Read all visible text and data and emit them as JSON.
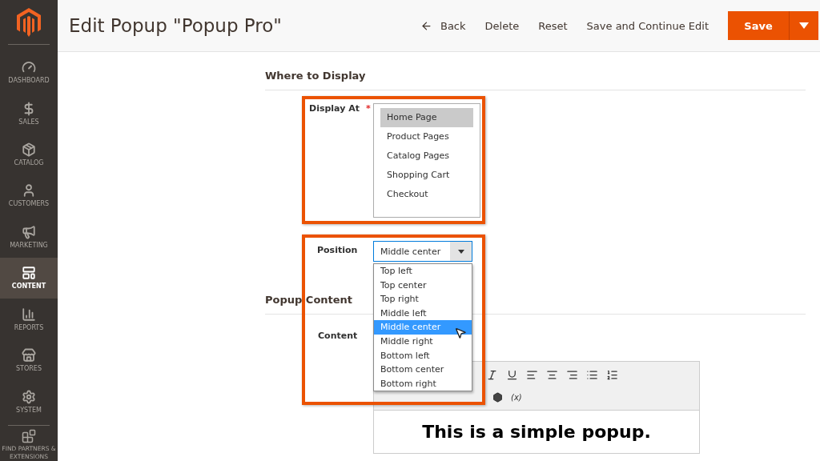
{
  "sidebar": {
    "items": [
      {
        "kind": "dashboard",
        "label": "DASHBOARD",
        "selected": false
      },
      {
        "kind": "sales",
        "label": "SALES",
        "selected": false
      },
      {
        "kind": "catalog",
        "label": "CATALOG",
        "selected": false
      },
      {
        "kind": "customers",
        "label": "CUSTOMERS",
        "selected": false
      },
      {
        "kind": "marketing",
        "label": "MARKETING",
        "selected": false
      },
      {
        "kind": "content",
        "label": "CONTENT",
        "selected": true
      },
      {
        "kind": "reports",
        "label": "REPORTS",
        "selected": false
      },
      {
        "kind": "stores",
        "label": "STORES",
        "selected": false
      },
      {
        "kind": "system",
        "label": "SYSTEM",
        "selected": false
      }
    ],
    "footer_item": {
      "label": "FIND PARTNERS & EXTENSIONS"
    }
  },
  "header": {
    "title": "Edit Popup \"Popup Pro\"",
    "actions": [
      {
        "kind": "back",
        "label": "Back"
      },
      {
        "kind": "plain",
        "label": "Delete"
      },
      {
        "kind": "plain",
        "label": "Reset"
      },
      {
        "kind": "plain",
        "label": "Save and Continue Edit"
      }
    ],
    "primary": "Save"
  },
  "display_section": {
    "title": "Where to Display",
    "label": "Display At",
    "required_mark": "*",
    "options": [
      {
        "label": "Home Page",
        "selected": true
      },
      {
        "label": "Product Pages",
        "selected": false
      },
      {
        "label": "Catalog Pages",
        "selected": false
      },
      {
        "label": "Shopping Cart",
        "selected": false
      },
      {
        "label": "Checkout",
        "selected": false
      }
    ]
  },
  "position": {
    "label": "Position",
    "value": "Middle center",
    "expanded": true,
    "options": [
      {
        "label": "Top left",
        "selected": false
      },
      {
        "label": "Top center",
        "selected": false
      },
      {
        "label": "Top right",
        "selected": false
      },
      {
        "label": "Middle left",
        "selected": false
      },
      {
        "label": "Middle center",
        "selected": true
      },
      {
        "label": "Middle right",
        "selected": false
      },
      {
        "label": "Bottom left",
        "selected": false
      },
      {
        "label": "Bottom center",
        "selected": false
      },
      {
        "label": "Bottom right",
        "selected": false
      }
    ]
  },
  "content_section": {
    "title": "Popup Content",
    "label": "Content",
    "variable_button": "(x)",
    "heading": "This is a simple popup."
  }
}
